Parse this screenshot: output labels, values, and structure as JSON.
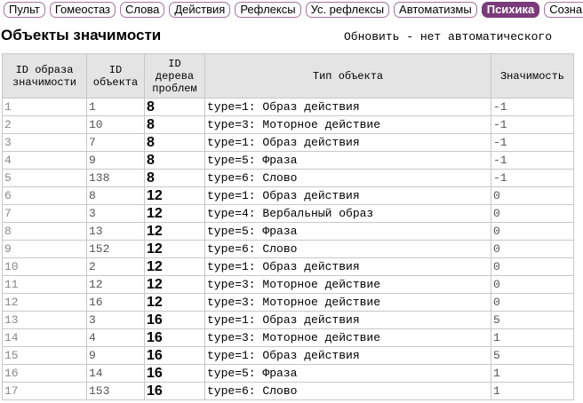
{
  "nav": {
    "tabs": [
      {
        "label": "Пульт",
        "active": false
      },
      {
        "label": "Гомеостаз",
        "active": false
      },
      {
        "label": "Слова",
        "active": false
      },
      {
        "label": "Действия",
        "active": false
      },
      {
        "label": "Рефлексы",
        "active": false
      },
      {
        "label": "Ус. рефлексы",
        "active": false
      },
      {
        "label": "Автоматизмы",
        "active": false
      },
      {
        "label": "Психика",
        "active": true
      },
      {
        "label": "Сознание",
        "active": false
      }
    ]
  },
  "page": {
    "title": "Объекты значимости",
    "refresh": "Обновить - нет автоматического"
  },
  "table": {
    "headers": {
      "image_id_1": "ID образа",
      "image_id_2": "значимости",
      "object_id_1": "ID",
      "object_id_2": "объекта",
      "tree_id_1": "ID",
      "tree_id_2": "дерева",
      "tree_id_3": "проблем",
      "type": "Тип объекта",
      "significance": "Значимость"
    },
    "rows": [
      {
        "id": "1",
        "obj": "1",
        "tree": "8",
        "type": "type=1: Образ действия",
        "sig": "-1"
      },
      {
        "id": "2",
        "obj": "10",
        "tree": "8",
        "type": "type=3: Моторное действие",
        "sig": "-1"
      },
      {
        "id": "3",
        "obj": "7",
        "tree": "8",
        "type": "type=1: Образ действия",
        "sig": "-1"
      },
      {
        "id": "4",
        "obj": "9",
        "tree": "8",
        "type": "type=5: Фраза",
        "sig": "-1"
      },
      {
        "id": "5",
        "obj": "138",
        "tree": "8",
        "type": "type=6: Слово",
        "sig": "-1"
      },
      {
        "id": "6",
        "obj": "8",
        "tree": "12",
        "type": "type=1: Образ действия",
        "sig": "0"
      },
      {
        "id": "7",
        "obj": "3",
        "tree": "12",
        "type": "type=4: Вербальный образ",
        "sig": "0"
      },
      {
        "id": "8",
        "obj": "13",
        "tree": "12",
        "type": "type=5: Фраза",
        "sig": "0"
      },
      {
        "id": "9",
        "obj": "152",
        "tree": "12",
        "type": "type=6: Слово",
        "sig": "0"
      },
      {
        "id": "10",
        "obj": "2",
        "tree": "12",
        "type": "type=1: Образ действия",
        "sig": "0"
      },
      {
        "id": "11",
        "obj": "12",
        "tree": "12",
        "type": "type=3: Моторное действие",
        "sig": "0"
      },
      {
        "id": "12",
        "obj": "16",
        "tree": "12",
        "type": "type=3: Моторное действие",
        "sig": "0"
      },
      {
        "id": "13",
        "obj": "3",
        "tree": "16",
        "type": "type=1: Образ действия",
        "sig": "5"
      },
      {
        "id": "14",
        "obj": "4",
        "tree": "16",
        "type": "type=3: Моторное действие",
        "sig": "1"
      },
      {
        "id": "15",
        "obj": "9",
        "tree": "16",
        "type": "type=1: Образ действия",
        "sig": "5"
      },
      {
        "id": "16",
        "obj": "14",
        "tree": "16",
        "type": "type=5: Фраза",
        "sig": "1"
      },
      {
        "id": "17",
        "obj": "153",
        "tree": "16",
        "type": "type=6: Слово",
        "sig": "1"
      }
    ]
  }
}
